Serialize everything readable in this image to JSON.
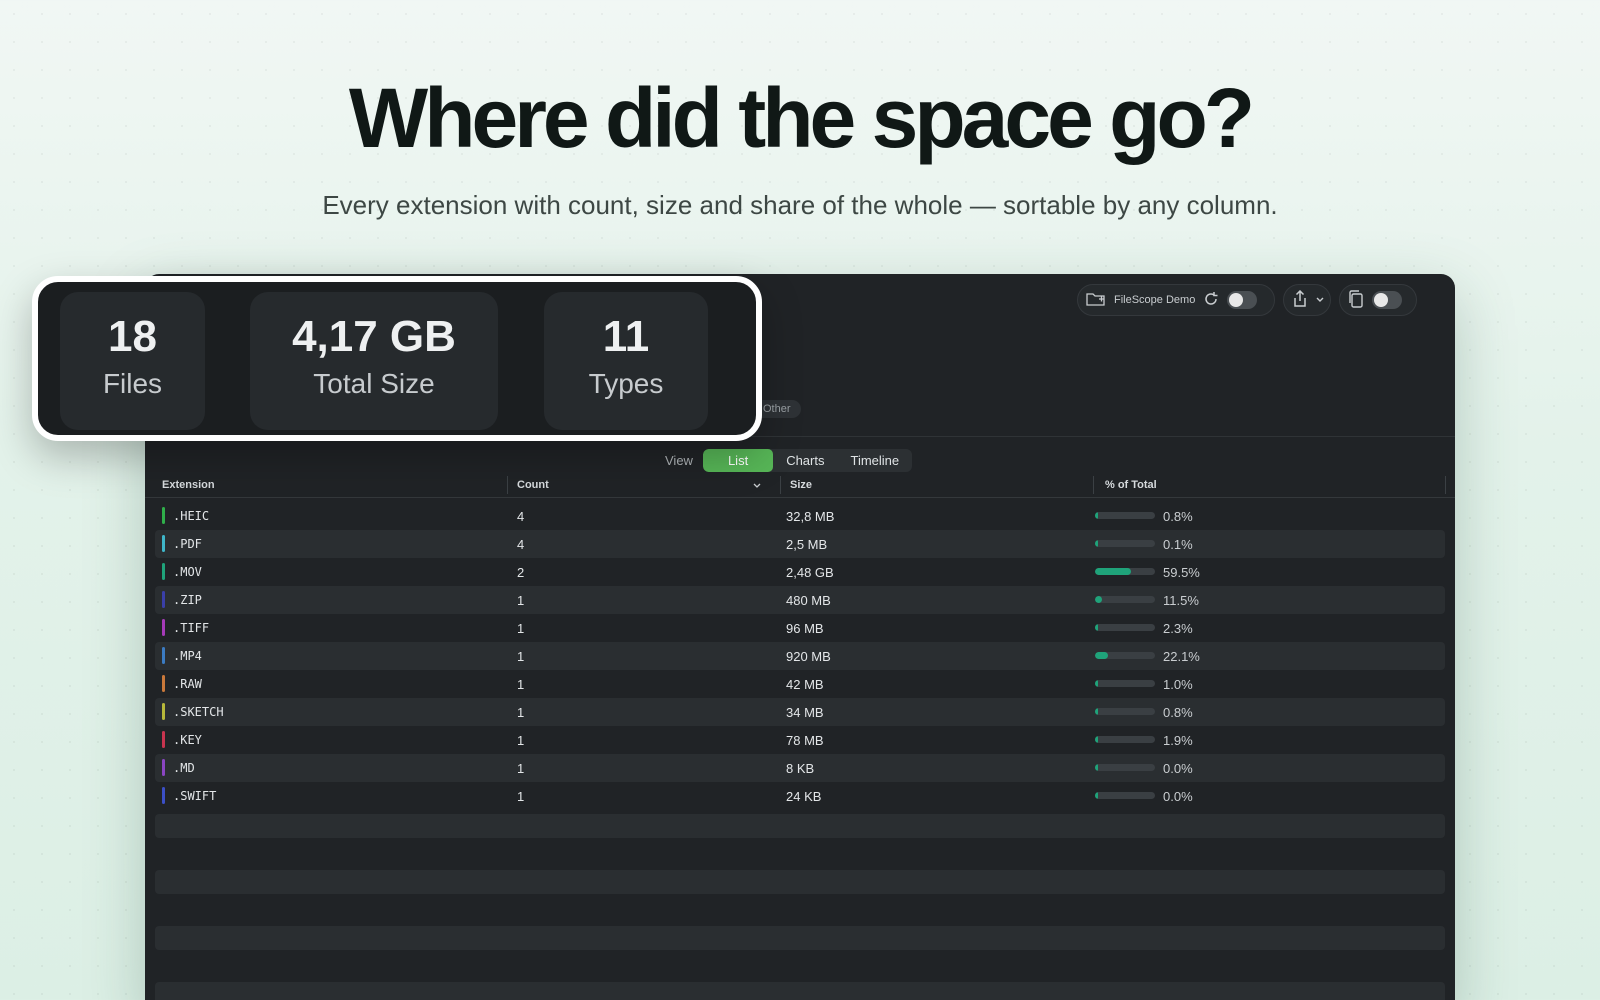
{
  "headline": "Where did the space go?",
  "subhead": "Every extension with count, size and share of the whole — sortable by any column.",
  "toolbar": {
    "location_label": "FileScope Demo"
  },
  "filter_other": "Other",
  "view": {
    "label": "View",
    "tabs": [
      "List",
      "Charts",
      "Timeline"
    ],
    "active": "List"
  },
  "table": {
    "headers": [
      "Extension",
      "Count",
      "Size",
      "% of Total"
    ],
    "sort_column": "Count",
    "rows": [
      {
        "ext": ".HEIC",
        "count": "4",
        "size": "32,8 MB",
        "pct": "0.8%",
        "share": 0.8,
        "color": "#2fae4a"
      },
      {
        "ext": ".PDF",
        "count": "4",
        "size": "2,5 MB",
        "pct": "0.1%",
        "share": 0.1,
        "color": "#3fb6c9"
      },
      {
        "ext": ".MOV",
        "count": "2",
        "size": "2,48 GB",
        "pct": "59.5%",
        "share": 59.5,
        "color": "#1fa37a"
      },
      {
        "ext": ".ZIP",
        "count": "1",
        "size": "480 MB",
        "pct": "11.5%",
        "share": 11.5,
        "color": "#3a3fa8"
      },
      {
        "ext": ".TIFF",
        "count": "1",
        "size": "96 MB",
        "pct": "2.3%",
        "share": 2.3,
        "color": "#a53ab8"
      },
      {
        "ext": ".MP4",
        "count": "1",
        "size": "920 MB",
        "pct": "22.1%",
        "share": 22.1,
        "color": "#3b7bc2"
      },
      {
        "ext": ".RAW",
        "count": "1",
        "size": "42 MB",
        "pct": "1.0%",
        "share": 1.0,
        "color": "#c9783a"
      },
      {
        "ext": ".SKETCH",
        "count": "1",
        "size": "34 MB",
        "pct": "0.8%",
        "share": 0.8,
        "color": "#b7b83a"
      },
      {
        "ext": ".KEY",
        "count": "1",
        "size": "78 MB",
        "pct": "1.9%",
        "share": 1.9,
        "color": "#c8344f"
      },
      {
        "ext": ".MD",
        "count": "1",
        "size": "8 KB",
        "pct": "0.0%",
        "share": 0.0,
        "color": "#8a45c2"
      },
      {
        "ext": ".SWIFT",
        "count": "1",
        "size": "24 KB",
        "pct": "0.0%",
        "share": 0.0,
        "color": "#3b4fc6"
      }
    ]
  },
  "stats": {
    "files_value": "18",
    "files_label": "Files",
    "size_value": "4,17 GB",
    "size_label": "Total Size",
    "types_value": "11",
    "types_label": "Types"
  }
}
